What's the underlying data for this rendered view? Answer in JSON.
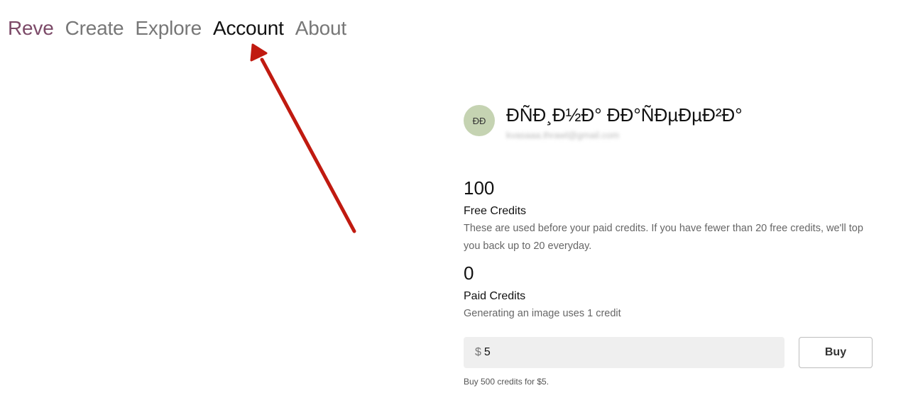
{
  "nav": {
    "brand": "Reve",
    "items": [
      "Create",
      "Explore",
      "Account",
      "About"
    ],
    "active": "Account"
  },
  "profile": {
    "avatar_initials": "ÐÐ",
    "name": "ÐÑÐ¸Ð½Ð° ÐÐ°ÑÐµÐµÐ²Ð°",
    "email": "kvasaaa.thrawl@gmail.com"
  },
  "free_credits": {
    "count": "100",
    "title": "Free Credits",
    "description": "These are used before your paid credits. If you have fewer than 20 free credits, we'll top you back up to 20 everyday."
  },
  "paid_credits": {
    "count": "0",
    "title": "Paid Credits",
    "description": "Generating an image uses 1 credit"
  },
  "purchase": {
    "currency_symbol": "$",
    "amount_value": "5",
    "buy_label": "Buy",
    "note": "Buy 500 credits for $5."
  },
  "colors": {
    "brand": "#7c4a68",
    "arrow": "#c01a10",
    "avatar_bg": "#c5d3b2"
  }
}
